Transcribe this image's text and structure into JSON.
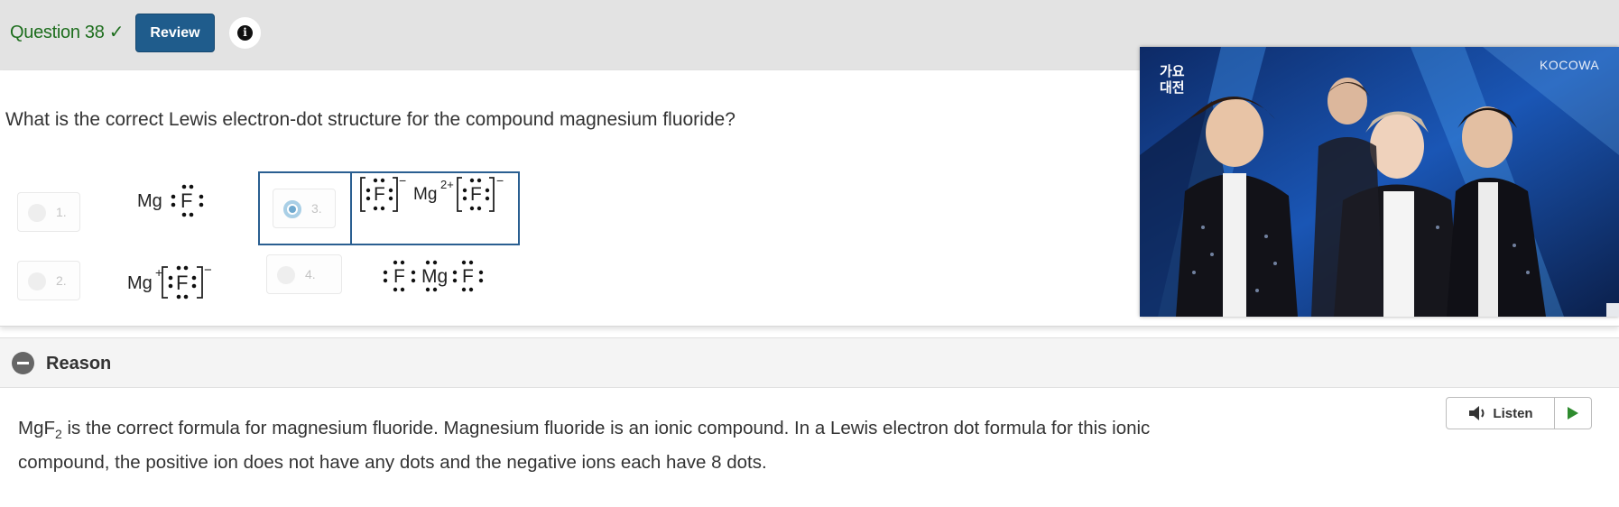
{
  "header": {
    "question_label": "Question 38 ✓",
    "review_label": "Review",
    "info_icon": "i"
  },
  "question": {
    "text": "What is the correct Lewis electron-dot structure for the compound magnesium fluoride?"
  },
  "options": [
    {
      "number": "1.",
      "formula_text": "Mg",
      "atom": "F"
    },
    {
      "number": "2.",
      "formula_text": "Mg",
      "charge": "+",
      "atom": "F",
      "anion_charge": "−"
    },
    {
      "number": "3.",
      "selected": true,
      "atom": "F",
      "cation": "Mg",
      "cation_charge": "2+",
      "anion_charge": "−"
    },
    {
      "number": "4.",
      "left_atom": "F",
      "center": "Mg",
      "right_atom": "F"
    }
  ],
  "video": {
    "watermark": "KOCOWA",
    "badge_line1": "가요",
    "badge_line2": "대전"
  },
  "reason": {
    "title": "Reason",
    "formula_base": "MgF",
    "formula_sub": "2",
    "text_after": " is the correct formula for magnesium fluoride. Magnesium fluoride is an ionic compound. In a Lewis electron dot formula for this ionic compound, the positive ion does not have any dots and the negative ions each have 8 dots."
  },
  "listen": {
    "label": "Listen",
    "speaker_icon": "speaker-icon",
    "play_icon": "play-icon"
  },
  "colors": {
    "header_bg": "#e3e3e3",
    "question_label": "#1e6e1e",
    "review_bg": "#1f5c8c",
    "selected_border": "#2a5f91",
    "play_green": "#2e8b2e"
  }
}
